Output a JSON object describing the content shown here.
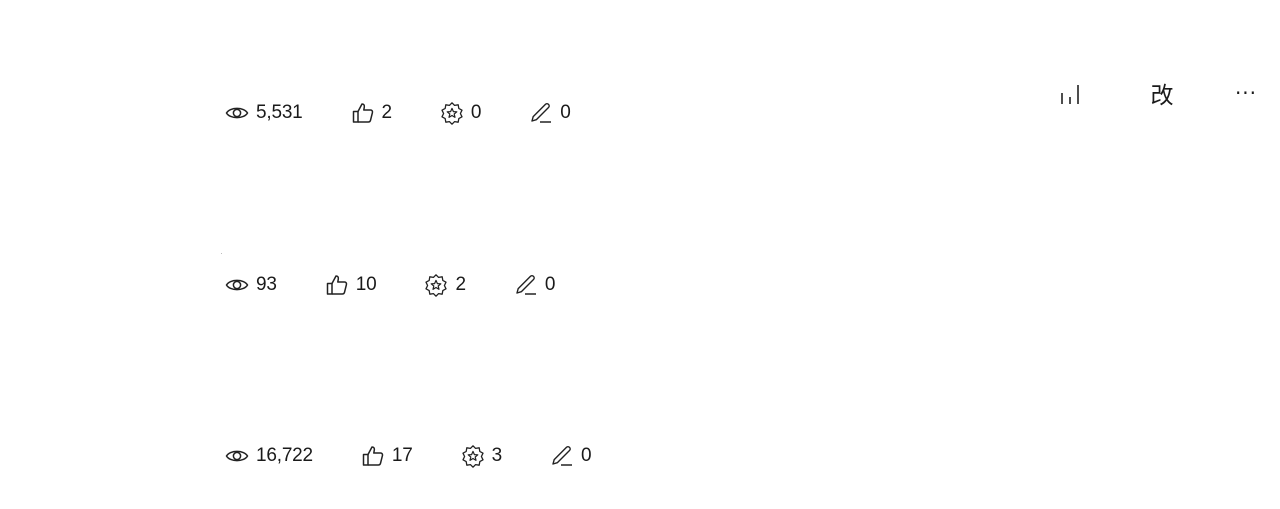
{
  "toolbar": {
    "chart_icon": "bar-chart-icon",
    "edit_label": "改",
    "more_label": "···"
  },
  "posts": [
    {
      "views": "5,531",
      "likes": "2",
      "favorites": "0",
      "comments": "0"
    },
    {
      "views": "93",
      "likes": "10",
      "favorites": "2",
      "comments": "0"
    },
    {
      "views": "16,722",
      "likes": "17",
      "favorites": "3",
      "comments": "0"
    }
  ],
  "icons": {
    "views": "eye-icon",
    "likes": "thumbs-up-icon",
    "favorites": "star-badge-icon",
    "comments": "pen-icon"
  }
}
